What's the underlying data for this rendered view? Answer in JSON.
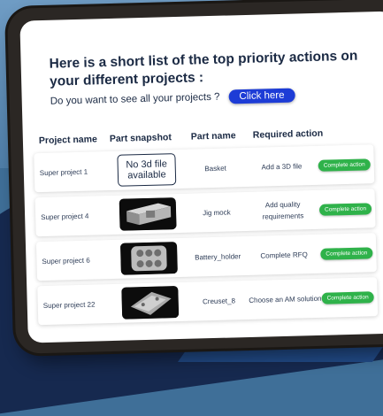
{
  "heading": "Here is a short list of the top priority actions on your different projects :",
  "subheading": {
    "prompt": "Do you want to see all your projects ?",
    "button_label": "Click here"
  },
  "table": {
    "headers": [
      "Project name",
      "Part snapshot",
      "Part name",
      "Required action"
    ],
    "rows": [
      {
        "project": "Super project 1",
        "snapshot_text": "No 3d file available",
        "part": "Basket",
        "action": "Add a 3D file",
        "button": "Complete action"
      },
      {
        "project": "Super project 4",
        "snapshot_icon": "jig-mock-render",
        "part": "Jig mock",
        "action": "Add quality requirements",
        "button": "Complete action"
      },
      {
        "project": "Super project 6",
        "snapshot_icon": "battery-holder-render",
        "part": "Battery_holder",
        "action": "Complete RFQ",
        "button": "Complete action"
      },
      {
        "project": "Super project 22",
        "snapshot_icon": "creuset-render",
        "part": "Creuset_8",
        "action": "Choose an AM solution",
        "button": "Complete action"
      }
    ]
  },
  "colors": {
    "primary_button": "#1d3cd6",
    "action_button": "#2fb24a",
    "text": "#1b2a44"
  }
}
